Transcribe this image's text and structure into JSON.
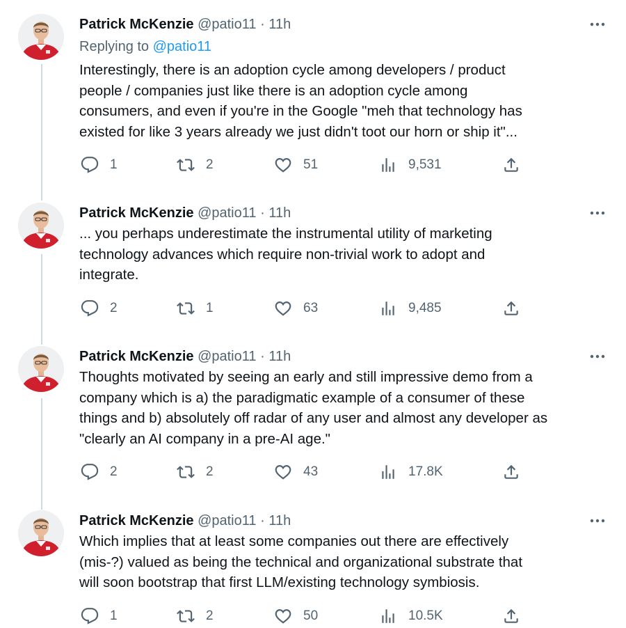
{
  "tweets": [
    {
      "author": "Patrick McKenzie",
      "handle": "@patio11",
      "sep": "·",
      "time": "11h",
      "replying_prefix": "Replying to ",
      "replying_to": "@patio11",
      "text": "Interestingly, there is an adoption cycle among developers / product\npeople / companies just like there is an adoption cycle among\nconsumers, and even if you're in the Google \"meh that technology has\nexisted for like 3 years already we just didn't toot our horn or ship it\"...",
      "replies": "1",
      "retweets": "2",
      "likes": "51",
      "views": "9,531"
    },
    {
      "author": "Patrick McKenzie",
      "handle": "@patio11",
      "sep": "·",
      "time": "11h",
      "text": "... you perhaps underestimate the instrumental utility of marketing\ntechnology advances which require non-trivial work to adopt and\nintegrate.",
      "replies": "2",
      "retweets": "1",
      "likes": "63",
      "views": "9,485"
    },
    {
      "author": "Patrick McKenzie",
      "handle": "@patio11",
      "sep": "·",
      "time": "11h",
      "text": "Thoughts motivated by seeing an early and still impressive demo from a\ncompany which is a) the paradigmatic example of a consumer of these\nthings and b) absolutely off radar of any user and almost any developer as\n\"clearly an AI company in a pre-AI age.\"",
      "replies": "2",
      "retweets": "2",
      "likes": "43",
      "views": "17.8K"
    },
    {
      "author": "Patrick McKenzie",
      "handle": "@patio11",
      "sep": "·",
      "time": "11h",
      "text": "Which implies that at least some companies out there are effectively\n(mis-?) valued as being the technical and organizational substrate that\nwill soon bootstrap that first LLM/existing technology symbiosis.",
      "replies": "1",
      "retweets": "2",
      "likes": "50",
      "views": "10.5K"
    }
  ],
  "icons": {
    "more": "more-icon",
    "reply": "reply-icon",
    "retweet": "retweet-icon",
    "like": "heart-icon",
    "views": "views-icon",
    "share": "share-icon"
  },
  "colors": {
    "text": "#0f1419",
    "secondary": "#536471",
    "link": "#1d9bf0",
    "thread_line": "#cfd9de",
    "jacket": "#d0202e"
  }
}
